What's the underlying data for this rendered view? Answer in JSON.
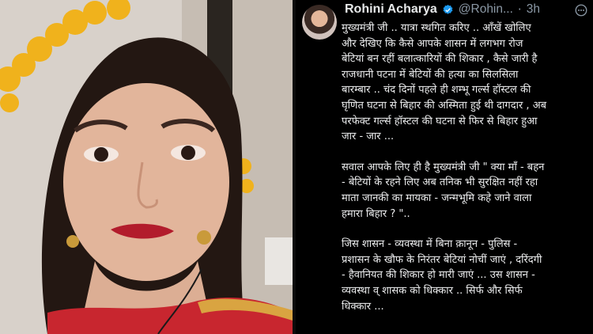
{
  "tweet": {
    "name": "Rohini Acharya",
    "handle": "@Rohin...",
    "separator": "·",
    "time": "3h",
    "paragraphs": [
      [
        "मुख्यमंत्री जी .. यात्रा स्थगित करिए .. आँखें खोलिए",
        "और देखिए कि कैसे आपके शासन में लगभग रोज",
        "बेटियां बन रहीं बलात्कारियों की शिकार , कैसे जारी है",
        "राजधानी पटना में बेटियों की हत्या का सिलसिला",
        "बारम्बार .. चंद दिनों पहले ही शम्भू गर्ल्स हॉस्टल की",
        "घृणित घटना से बिहार की अस्मिता हुई थी दागदार , अब",
        "परफेक्ट गर्ल्स हॉस्टल की घटना से फिर से बिहार हुआ",
        "जार - जार ..."
      ],
      [
        "सवाल आपके लिए ही है मुख्यमंत्री जी \" क्या माँ - बहन",
        "- बेटियों के रहने लिए अब तनिक भी सुरक्षित नहीं रहा",
        "माता जानकी का मायका - जन्मभूमि कहे जाने वाला",
        "हमारा बिहार ? \".."
      ],
      [
        "जिस शासन - व्यवस्था में बिना क़ानून - पुलिस -",
        "प्रशासन के खौफ के निरंतर बेटियां नोचीं जाएं , दरिंदगी",
        "- हैवानियत की शिकार हो मारी जाएं ... उस शासन -",
        "व्यवस्था व् शासक को धिक्कार .. सिर्फ और सिर्फ",
        "धिक्कार ..."
      ]
    ]
  },
  "icons": {
    "verified": "verified-badge-icon",
    "more": "more-options-icon"
  },
  "colors": {
    "background": "#000000",
    "text": "#e7e9ea",
    "muted": "#8b98a5",
    "verified": "#1d9bf0"
  }
}
